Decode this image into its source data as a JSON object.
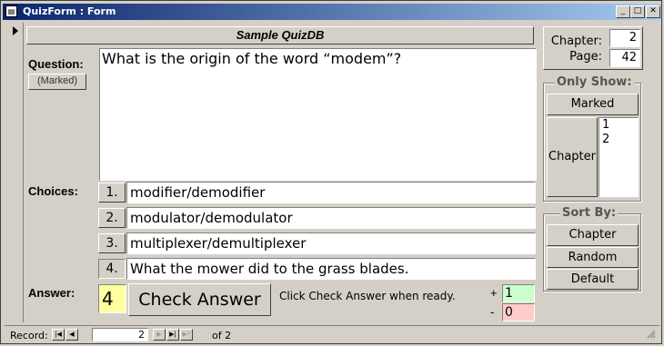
{
  "window": {
    "title": "QuizForm : Form",
    "icon_text": "▤"
  },
  "form": {
    "header": "Sample QuizDB",
    "question_label": "Question:",
    "marked_button": "(Marked)",
    "question_text": "What is the origin of the word “modem”?",
    "choices_label": "Choices:",
    "choices": [
      {
        "num": "1.",
        "text": "modifier/demodifier"
      },
      {
        "num": "2.",
        "text": "modulator/demodulator"
      },
      {
        "num": "3.",
        "text": "multiplexer/demultiplexer"
      },
      {
        "num": "4.",
        "text": "What the mower did to the grass blades."
      }
    ],
    "answer_label": "Answer:",
    "answer_value": "4",
    "check_button": "Check Answer",
    "hint": "Click Check Answer when ready.",
    "plus_sign": "+",
    "minus_sign": "-",
    "correct_count": "1",
    "wrong_count": "0"
  },
  "right": {
    "chapter_label": "Chapter:",
    "chapter_value": "2",
    "page_label": "Page:",
    "page_value": "42",
    "only_show_title": "Only Show:",
    "marked_button": "Marked",
    "chapter_button": "Chapter",
    "chapter_list": [
      "1",
      "2"
    ],
    "sort_by_title": "Sort By:",
    "sort_buttons": [
      "Chapter",
      "Random",
      "Default"
    ]
  },
  "status": {
    "record_label": "Record:",
    "record_value": "2",
    "of_text": "of 2",
    "nav_first": "|◀",
    "nav_prev": "◀",
    "nav_next": "▶",
    "nav_last": "▶|",
    "nav_new": "▶*"
  },
  "colors": {
    "title_start": "#0a246a",
    "title_end": "#a6caf0",
    "answer_bg": "#ffffa0",
    "correct_bg": "#ccffcc",
    "wrong_bg": "#ffcccc"
  }
}
